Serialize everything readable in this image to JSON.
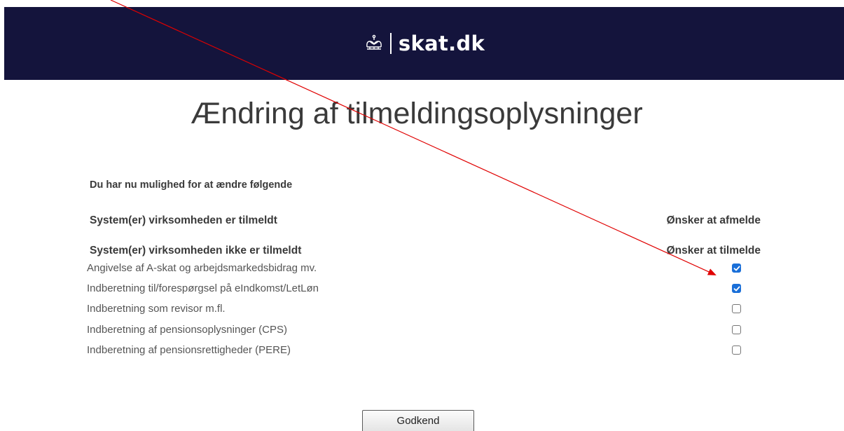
{
  "header": {
    "brand_name": "skat.dk",
    "logo_icon": "crown-icon",
    "background_color": "#14143c"
  },
  "page": {
    "title": "Ændring af tilmeldingsoplysninger",
    "intro": "Du har nu mulighed for at ændre følgende"
  },
  "registered_section": {
    "heading": "System(er) virksomheden er tilmeldt",
    "action_heading": "Ønsker at afmelde"
  },
  "unregistered_section": {
    "heading": "System(er) virksomheden ikke er tilmeldt",
    "action_heading": "Ønsker at tilmelde",
    "items": [
      {
        "label": "Angivelse af A-skat og arbejdsmarkedsbidrag mv.",
        "checked": true
      },
      {
        "label": "Indberetning til/forespørgsel på eIndkomst/LetLøn",
        "checked": true
      },
      {
        "label": "Indberetning som revisor m.fl.",
        "checked": false
      },
      {
        "label": "Indberetning af pensionsoplysninger (CPS)",
        "checked": false
      },
      {
        "label": "Indberetning af pensionsrettigheder (PERE)",
        "checked": false
      }
    ]
  },
  "actions": {
    "approve_label": "Godkend"
  },
  "colors": {
    "checkbox_checked": "#1a6fd8",
    "annotation_arrow": "#e00000"
  }
}
